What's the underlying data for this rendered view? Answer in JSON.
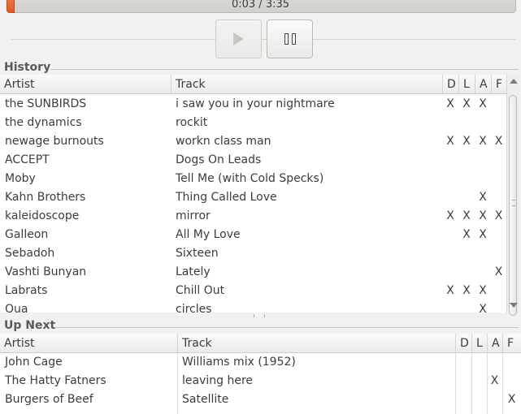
{
  "player": {
    "time_display": "0:03 / 3:35",
    "progress_fraction": 0.014,
    "play_icon": "play-icon",
    "pause_icon": "pause-icon",
    "accent_color": "#e8662e"
  },
  "history": {
    "title": "History",
    "columns": {
      "artist": "Artist",
      "track": "Track",
      "d": "D",
      "l": "L",
      "a": "A",
      "f": "F"
    },
    "rows": [
      {
        "artist": "the SUNBIRDS",
        "track": "i saw you in your nightmare",
        "d": "X",
        "l": "X",
        "a": "X",
        "f": ""
      },
      {
        "artist": "the dynamics",
        "track": "rockit",
        "d": "",
        "l": "",
        "a": "",
        "f": ""
      },
      {
        "artist": "newage burnouts",
        "track": "workn class man",
        "d": "X",
        "l": "X",
        "a": "X",
        "f": "X"
      },
      {
        "artist": "ACCEPT",
        "track": "Dogs On Leads",
        "d": "",
        "l": "",
        "a": "",
        "f": ""
      },
      {
        "artist": "Moby",
        "track": "Tell Me (with Cold Specks)",
        "d": "",
        "l": "",
        "a": "",
        "f": ""
      },
      {
        "artist": "Kahn Brothers",
        "track": "Thing Called Love",
        "d": "",
        "l": "",
        "a": "X",
        "f": ""
      },
      {
        "artist": "kaleidoscope",
        "track": "mirror",
        "d": "X",
        "l": "X",
        "a": "X",
        "f": "X"
      },
      {
        "artist": "Galleon",
        "track": "All My Love",
        "d": "",
        "l": "X",
        "a": "X",
        "f": ""
      },
      {
        "artist": "Sebadoh",
        "track": "Sixteen",
        "d": "",
        "l": "",
        "a": "",
        "f": ""
      },
      {
        "artist": "Vashti Bunyan",
        "track": "Lately",
        "d": "",
        "l": "",
        "a": "",
        "f": "X"
      },
      {
        "artist": "Labrats",
        "track": "Chill Out",
        "d": "X",
        "l": "X",
        "a": "X",
        "f": ""
      },
      {
        "artist": "Qua",
        "track": "circles",
        "d": "",
        "l": "",
        "a": "X",
        "f": ""
      }
    ]
  },
  "up_next": {
    "title": "Up Next",
    "columns": {
      "artist": "Artist",
      "track": "Track",
      "d": "D",
      "l": "L",
      "a": "A",
      "f": "F"
    },
    "rows": [
      {
        "artist": "John Cage",
        "track": "Williams mix (1952)",
        "d": "",
        "l": "",
        "a": "",
        "f": ""
      },
      {
        "artist": "The Hatty Fatners",
        "track": "leaving here",
        "d": "",
        "l": "",
        "a": "X",
        "f": ""
      },
      {
        "artist": "Burgers of Beef",
        "track": "Satellite",
        "d": "",
        "l": "",
        "a": "",
        "f": "X"
      }
    ]
  }
}
